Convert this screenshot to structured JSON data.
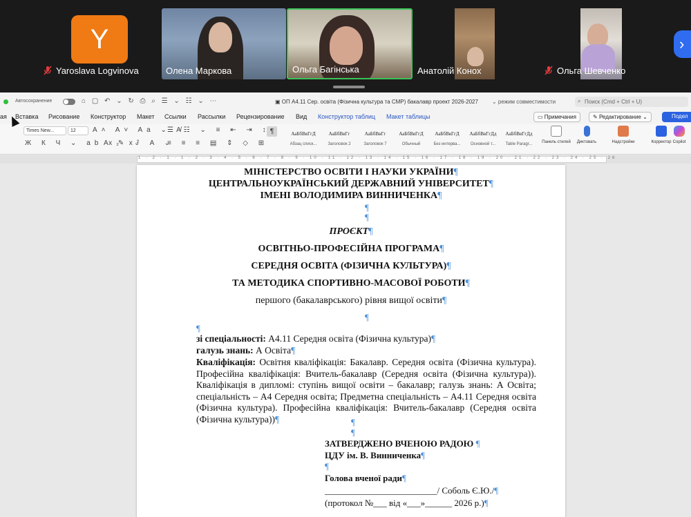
{
  "meeting": {
    "participants": [
      {
        "name": "Yaroslava Logvinova",
        "initial": "Y",
        "muted": true
      },
      {
        "name": "Олена Маркова",
        "muted": false
      },
      {
        "name": "Ольга Багінська",
        "muted": false,
        "active_speaker": true
      },
      {
        "name": "Анатолій Конох",
        "muted": false
      },
      {
        "name": "Ольга Шевченко",
        "muted": true
      }
    ],
    "next_icon": "chevron-right-icon",
    "colors": {
      "avatar": "#f07a14",
      "active_border": "#3ac45a",
      "next_button": "#2f6cf0"
    }
  },
  "word": {
    "autosave_label": "Автосохранение",
    "doc_title": "ОП А4.11 Сер. освіта (Фізична культура та СМР) бакалавр проект 2026-2027",
    "mode": "⌄ режим совместимости",
    "search_placeholder": "Поиск (Cmd + Ctrl + U)",
    "tabs": [
      "ая",
      "Вставка",
      "Рисование",
      "Конструктор",
      "Макет",
      "Ссылки",
      "Рассылки",
      "Рецензирование",
      "Вид",
      "Конструктор таблиц",
      "Макет таблицы"
    ],
    "comments_label": "Примечания",
    "editing_label": "Редактирование ⌄",
    "share_label": "Подел",
    "font_name": "Times New...",
    "font_size": "12",
    "styles": [
      {
        "sample": "АаБбВвГгД",
        "name": "Абзац списк..."
      },
      {
        "sample": "АаБбВвГг",
        "name": "Заголовок 2"
      },
      {
        "sample": "АаБбВвГг",
        "name": "Заголовок 7"
      },
      {
        "sample": "АаБбВвГгД",
        "name": "Обычный"
      },
      {
        "sample": "АаБбВвГгД",
        "name": "Без интерва..."
      },
      {
        "sample": "АаБбВвГгДд",
        "name": "Основной т..."
      },
      {
        "sample": "АаБбВвГгДд",
        "name": "Table Paragr..."
      }
    ],
    "ribbon_buttons": {
      "styles_pane": "Панель стилей",
      "dictate": "Диктовать",
      "addins": "Надстройки",
      "editor": "Корректор",
      "copilot": "Copilot"
    },
    "ruler_ticks": "1 · 2 · 1 · 1 · 2 · 3 · 4 · 5 · 6 · 7 · 8 · 9 · 10 · 11 · 12 · 13 · 14 · 15 · 16 · 17 · 18 · 19 · 20 · 21 · 22 · 23 · 24 · 25 · 26"
  },
  "document": {
    "pilcrow": "¶",
    "ministry": "МІНІСТЕРСТВО ОСВІТИ І НАУКИ УКРАЇНИ",
    "university": "ЦЕНТРАЛЬНОУКРАЇНСЬКИЙ ДЕРЖАВНИЙ УНІВЕРСИТЕТ",
    "named_after": "ІМЕНІ ВОЛОДИМИРА ВИННИЧЕНКА",
    "project": "ПРОЄКТ",
    "program_type": "ОСВІТНЬО-ПРОФЕСІЙНА ПРОГРАМА",
    "program_name_1": "СЕРЕДНЯ ОСВІТА (ФІЗИЧНА КУЛЬТУРА)",
    "program_name_2": "ТА МЕТОДИКА СПОРТИВНО-МАСОВОЇ РОБОТИ",
    "level": "першого (бакалаврського) рівня вищої освіти",
    "specialty_label": "зі спеціальності:",
    "specialty_value": " А4.11 Середня освіта (Фізична культура)",
    "field_label": "галузь знань:",
    "field_value": " А Освіта",
    "qual_label": "Кваліфікація:",
    "qual_value": " Освітня кваліфікація: Бакалавр. Середня освіта (Фізична культура). Професійна кваліфікація: Вчитель-бакалавр (Середня освіта (Фізична культура)). Кваліфікація в дипломі: ступінь вищої освіти – бакалавр; галузь знань: А Освіта; спеціальність – А4 Середня освіта; Предметна спеціальність – А4.11 Середня освіта (Фізична культура). Професійна кваліфікація: Вчитель-бакалавр (Середня освіта (Фізична культура))",
    "approved_1": "ЗАТВЕРДЖЕНО ВЧЕНОЮ РАДОЮ ",
    "approved_2": "ЦДУ ім. В. Винниченка",
    "head": "Голова вченої ради",
    "signature": "_________________________/ Соболь Є.Ю./",
    "protocol": "(протокол №___ від «___»______ 2026 р.)"
  }
}
